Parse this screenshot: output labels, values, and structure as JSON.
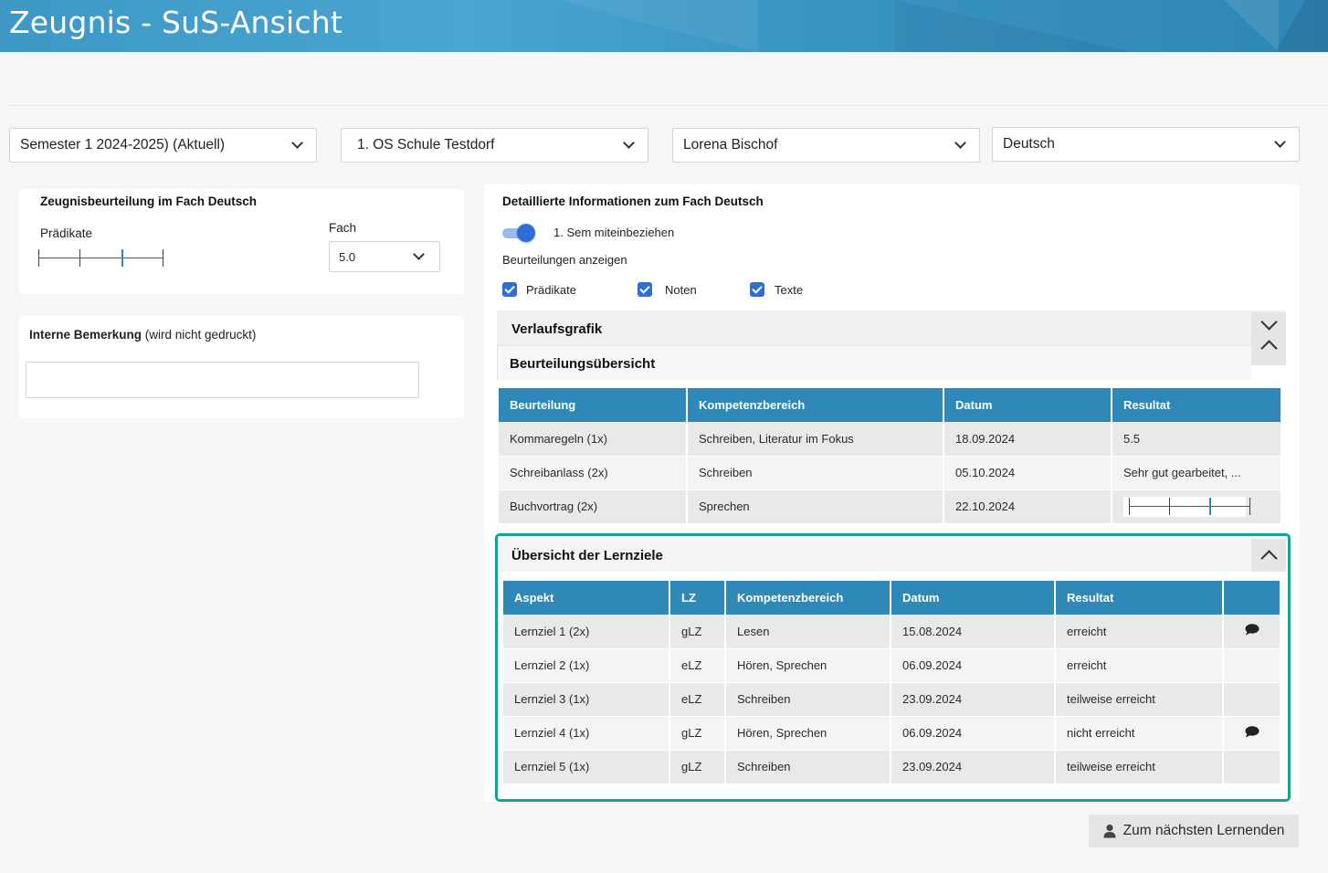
{
  "header": {
    "title": "Zeugnis - SuS-Ansicht"
  },
  "filters": {
    "semester": "Semester 1 2024-2025)  (Aktuell)",
    "school": "1. OS Schule Testdorf",
    "student": "Lorena Bischof",
    "subject": "Deutsch"
  },
  "grade_card": {
    "title": "Zeugnisbeurteilung im Fach Deutsch",
    "predicate_label": "Prädikate",
    "predicate_level": 3,
    "predicate_scale_max": 4,
    "subject_label": "Fach",
    "subject_grade": "5.0"
  },
  "remark_card": {
    "title_bold": "Interne Bemerkung",
    "title_note": " (wird nicht gedruckt)",
    "value": ""
  },
  "detail": {
    "title": "Detaillierte Informationen zum Fach Deutsch",
    "toggle_label": "1. Sem miteinbeziehen",
    "toggle_on": true,
    "show_label": "Beurteilungen anzeigen",
    "checkboxes": [
      {
        "label": "Prädikate",
        "checked": true
      },
      {
        "label": "Noten",
        "checked": true
      },
      {
        "label": "Texte",
        "checked": true
      }
    ],
    "chart_section": "Verlaufsgrafik",
    "overview_section": "Beurteilungsübersicht",
    "overview_table": {
      "headers": [
        "Beurteilung",
        "Kompetenzbereich",
        "Datum",
        "Resultat"
      ],
      "rows": [
        [
          "Kommaregeln (1x)",
          "Schreiben, Literatur im Fokus",
          "18.09.2024",
          "5.5"
        ],
        [
          "Schreibanlass (2x)",
          "Schreiben",
          "05.10.2024",
          "Sehr gut gearbeitet, ..."
        ],
        [
          "Buchvortrag (2x)",
          "Sprechen",
          "22.10.2024",
          ""
        ]
      ],
      "row3_predicate_level": 3
    },
    "goals_section": "Übersicht der Lernziele",
    "goals_table": {
      "headers": [
        "Aspekt",
        "LZ",
        "Kompetenzbereich",
        "Datum",
        "Resultat",
        ""
      ],
      "rows": [
        [
          "Lernziel 1 (2x)",
          "gLZ",
          "Lesen",
          "15.08.2024",
          "erreicht",
          "comment"
        ],
        [
          "Lernziel 2 (1x)",
          "eLZ",
          "Hören, Sprechen",
          "06.09.2024",
          "erreicht",
          ""
        ],
        [
          "Lernziel 3 (1x)",
          "eLZ",
          "Schreiben",
          "23.09.2024",
          "teilweise erreicht",
          ""
        ],
        [
          "Lernziel 4 (1x)",
          "gLZ",
          "Hören, Sprechen",
          "06.09.2024",
          "nicht erreicht",
          "comment"
        ],
        [
          "Lernziel 5 (1x)",
          "gLZ",
          "Schreiben",
          "23.09.2024",
          "teilweise erreicht",
          ""
        ]
      ]
    }
  },
  "next_button": {
    "label": "Zum nächsten Lernenden",
    "icon": "user-icon"
  },
  "colors": {
    "header": "#3d98c5",
    "table_header": "#2e88b8",
    "accent": "#2d6fd6",
    "highlight": "#14a38e"
  }
}
